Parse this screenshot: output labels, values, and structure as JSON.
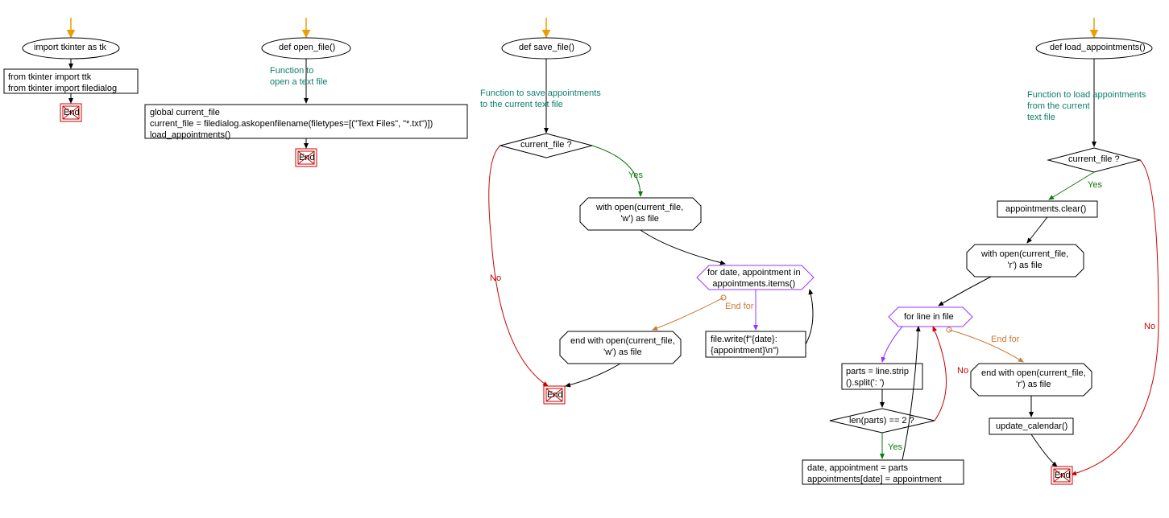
{
  "col1": {
    "start_label": "import tkinter as tk",
    "code": "from tkinter import ttk\nfrom tkinter import filedialog",
    "end": "End"
  },
  "col2": {
    "start_label": "def open_file()",
    "comment": "Function to\nopen a text file",
    "code": "global current_file\ncurrent_file = filedialog.askopenfilename(filetypes=[(\"Text Files\", \"*.txt\")])\nload_appointments()",
    "end": "End"
  },
  "col3": {
    "start_label": "def save_file()",
    "comment": "Function to save appointments\nto the current text file",
    "decision": "current_file ?",
    "yes": "Yes",
    "no": "No",
    "with_open": "with open(current_file,\n'w') as file",
    "for_loop": "for date, appointment in\nappointments.items()",
    "end_for": "End for",
    "write": "file.write(f\"{date}:\n{appointment}\\n\")",
    "end_with": "end with open(current_file,\n'w') as file",
    "end": "End"
  },
  "col4": {
    "start_label": "def load_appointments()",
    "comment": "Function to load appointments\nfrom the current\ntext file",
    "decision": "current_file ?",
    "yes": "Yes",
    "no": "No",
    "clear": "appointments.clear()",
    "with_open": "with open(current_file,\n'r') as file",
    "for_loop": "for line in file",
    "end_for": "End for",
    "parts": "parts = line.strip\n().split(': ')",
    "len_decision": "len(parts) == 2 ?",
    "yes2": "Yes",
    "no2": "No",
    "assign": "date, appointment = parts\nappointments[date] = appointment",
    "end_with": "end with open(current_file,\n'r') as file",
    "update": "update_calendar()",
    "end": "End"
  }
}
